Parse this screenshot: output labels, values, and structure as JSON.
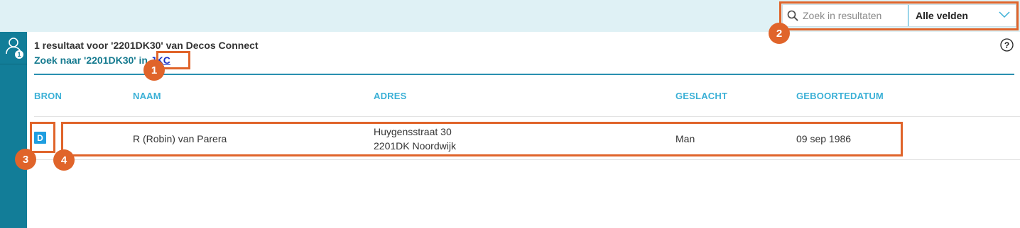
{
  "search": {
    "placeholder": "Zoek in resultaten",
    "field_label": "Alle velden"
  },
  "sidebar": {
    "user_badge": "1"
  },
  "header": {
    "result_title": "1 resultaat voor '2201DK30' van Decos Connect",
    "search_for_prefix": "Zoek naar '2201DK30' in",
    "search_for_link": "JKC"
  },
  "table": {
    "columns": [
      "BRON",
      "NAAM",
      "ADRES",
      "GESLACHT",
      "GEBOORTEDATUM"
    ],
    "rows": [
      {
        "bron": "D",
        "naam": "R (Robin) van Parera",
        "adres_line1": "Huygensstraat 30",
        "adres_line2": "2201DK Noordwijk",
        "geslacht": "Man",
        "geboortedatum": "09 sep 1986"
      }
    ]
  },
  "annotations": [
    "1",
    "2",
    "3",
    "4"
  ],
  "colors": {
    "sidebar": "#127d98",
    "topbar": "#dff1f5",
    "accent": "#3bb0d6",
    "annotation": "#e0642a",
    "bron_badge": "#1e9ee0"
  }
}
